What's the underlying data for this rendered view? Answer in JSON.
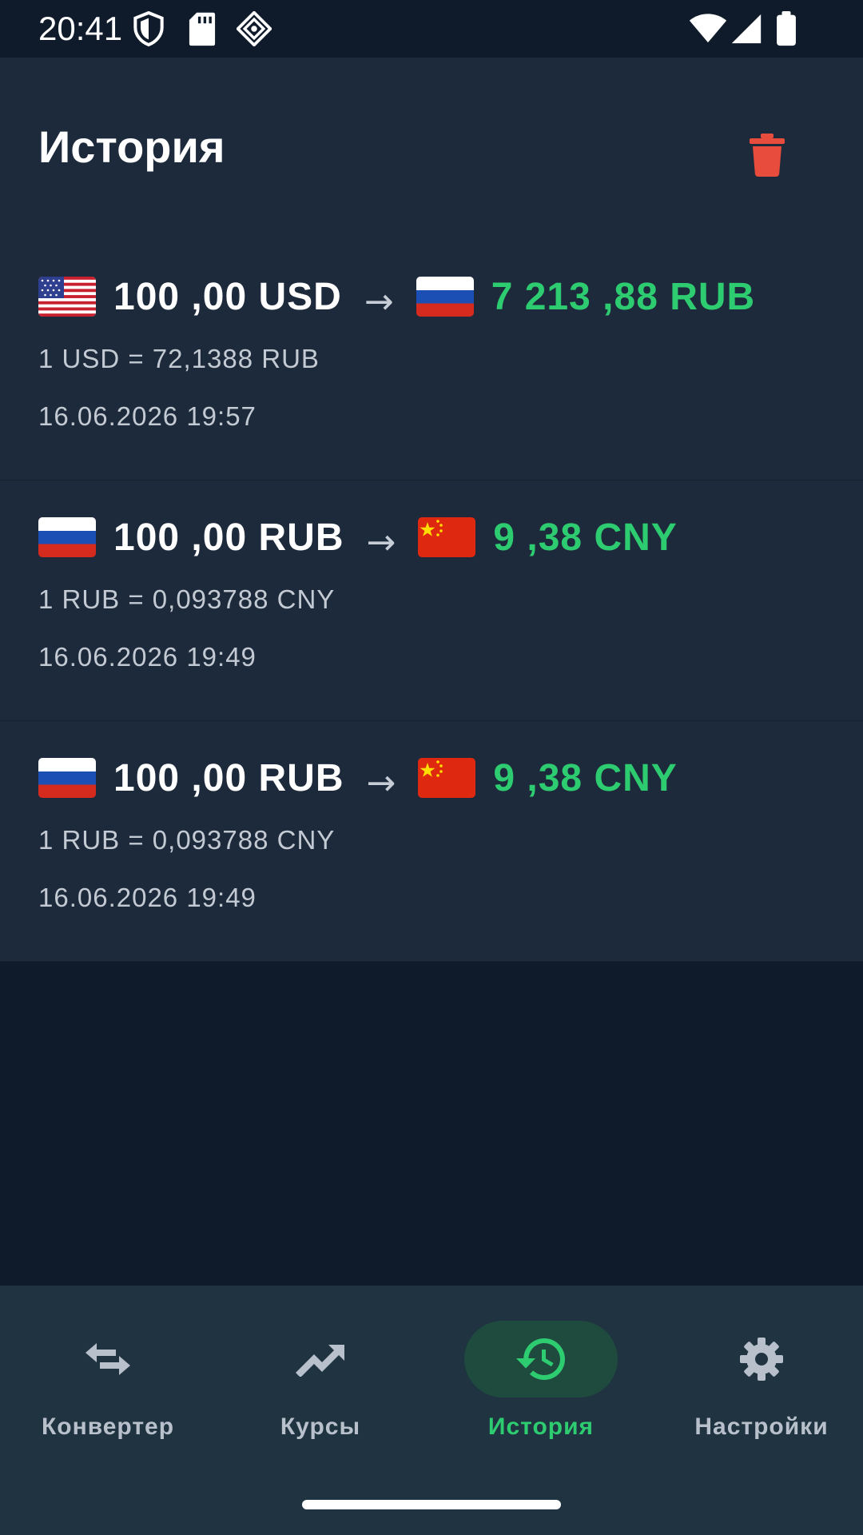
{
  "status_bar": {
    "time": "20:41",
    "icons": [
      "shield-icon",
      "sd-card-icon",
      "vpn-icon",
      "wifi-icon",
      "signal-icon",
      "battery-icon"
    ]
  },
  "header": {
    "title": "История",
    "delete_icon": "trash-icon",
    "delete_color": "#e74c3c"
  },
  "colors": {
    "accent": "#2ecc71",
    "background": "#0f1a2a",
    "card": "#1d2a3b",
    "nav_background": "#1f3340"
  },
  "history": [
    {
      "from_flag": "flag-us-icon",
      "from_amount": "100 ,00 USD",
      "arrow": "→",
      "to_flag": "flag-ru-icon",
      "to_amount": "7 213 ,88 RUB",
      "rate": "1 USD = 72,1388 RUB",
      "date": "16.06.2026 19:57"
    },
    {
      "from_flag": "flag-ru-icon",
      "from_amount": "100 ,00 RUB",
      "arrow": "→",
      "to_flag": "flag-cn-icon",
      "to_amount": "9 ,38 CNY",
      "rate": "1 RUB = 0,093788 CNY",
      "date": "16.06.2026 19:49"
    },
    {
      "from_flag": "flag-ru-icon",
      "from_amount": "100 ,00 RUB",
      "arrow": "→",
      "to_flag": "flag-cn-icon",
      "to_amount": "9 ,38 CNY",
      "rate": "1 RUB = 0,093788 CNY",
      "date": "16.06.2026 19:49"
    }
  ],
  "nav": {
    "items": [
      {
        "label": "Конвертер",
        "icon": "swap-icon",
        "active": false
      },
      {
        "label": "Курсы",
        "icon": "trending-up-icon",
        "active": false
      },
      {
        "label": "История",
        "icon": "history-icon",
        "active": true
      },
      {
        "label": "Настройки",
        "icon": "gear-icon",
        "active": false
      }
    ]
  }
}
